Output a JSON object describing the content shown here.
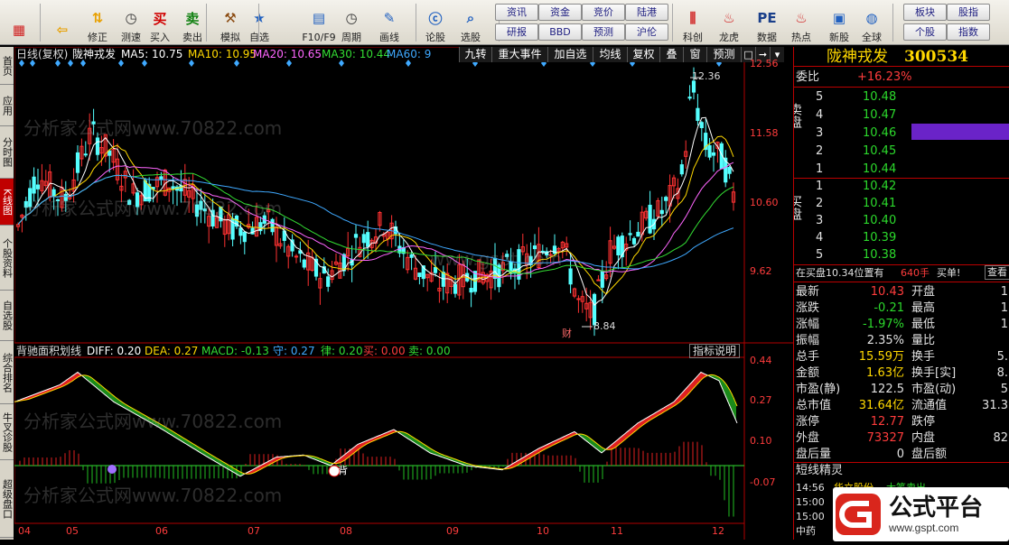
{
  "toolbar": {
    "left": [
      {
        "name": "grid-view",
        "label": "",
        "icon": "grid-icon"
      },
      {
        "name": "back",
        "label": "",
        "icon": "back-arrow-icon"
      },
      {
        "name": "correct",
        "label": "修正",
        "icon": "up-down-icon"
      },
      {
        "name": "test",
        "label": "测速",
        "icon": "clock-icon"
      },
      {
        "name": "buy",
        "label": "买入",
        "icon": "buy-icon",
        "glyph": "买"
      },
      {
        "name": "sell",
        "label": "卖出",
        "icon": "sell-icon",
        "glyph": "卖"
      },
      {
        "name": "simulate",
        "label": "模拟",
        "icon": "hammer-icon"
      },
      {
        "name": "self-select",
        "label": "自选",
        "icon": "star-icon"
      },
      {
        "name": "f10",
        "label": "F10/F9",
        "icon": "doc-icon"
      },
      {
        "name": "period",
        "label": "周期",
        "icon": "clock-icon"
      },
      {
        "name": "draw",
        "label": "画线",
        "icon": "pencil-icon"
      },
      {
        "name": "comment",
        "label": "论股",
        "icon": "forum-icon"
      },
      {
        "name": "select",
        "label": "选股",
        "icon": "magnifier-icon"
      },
      {
        "name": "chart",
        "label": "",
        "icon": "chart-icon"
      },
      {
        "name": "kbox",
        "label": "科创",
        "icon": "kchart-icon"
      },
      {
        "name": "dragon",
        "label": "龙虎",
        "icon": "dragon-icon"
      },
      {
        "name": "data",
        "label": "数据",
        "icon": "pe-icon",
        "glyph": "PE"
      },
      {
        "name": "hot",
        "label": "热点",
        "icon": "fire-icon"
      },
      {
        "name": "newstock",
        "label": "新股",
        "icon": "newstock-icon"
      },
      {
        "name": "global",
        "label": "全球",
        "icon": "globe-icon"
      }
    ],
    "small_buttons": [
      "资讯",
      "资金",
      "竞价",
      "陆港",
      "研报",
      "BBD",
      "预测",
      "沪伦",
      "板块",
      "股指",
      "个股",
      "指数"
    ]
  },
  "left_tabs": [
    "首页",
    "应用",
    "分时图",
    "K线图",
    "个股资料",
    "自选股",
    "综合排名",
    "牛叉诊股",
    "超级盘口"
  ],
  "chart_header": {
    "period": "日线(复权)",
    "name": "陇神戎发",
    "ma5_label": "MA5: 10.75",
    "ma10_label": "MA10: 10.95",
    "ma20_label": "MA20: 10.65",
    "ma30_label": "MA30: 10.44",
    "ma60_label": "MA60: 9",
    "tabs": [
      "九转",
      "重大事件",
      "加自选",
      "均线",
      "复权",
      "叠",
      "窗",
      "预测"
    ]
  },
  "price_axis": [
    "12.56",
    "11.58",
    "10.60",
    "9.62"
  ],
  "price_annotations": {
    "high": "12.36",
    "low": "8.84",
    "cai": "财"
  },
  "indicator_header": {
    "name": "背驰面积划线",
    "diff": "DIFF: 0.20",
    "dea": "DEA: 0.27",
    "macd": "MACD: -0.13",
    "shou": "守: 0.27",
    "lv": "律: 0.20",
    "buy": "买: 0.00",
    "sell": "卖: 0.00",
    "help": "指标说明"
  },
  "indicator_axis": [
    "0.44",
    "0.27",
    "0.10",
    "-0.07"
  ],
  "indicator_marks": {
    "bei": "背"
  },
  "x_axis": [
    "04",
    "05",
    "06",
    "07",
    "08",
    "09",
    "10",
    "11",
    "12"
  ],
  "watermark": [
    "分析家公式网www.70822.com",
    "www.gspt.com"
  ],
  "quote": {
    "name": "陇神戎发",
    "code": "300534",
    "weibi_label": "委比",
    "weibi": "+16.23%",
    "sell_side_label": "卖盘",
    "buy_side_label": "买盘",
    "asks": [
      {
        "lv": "5",
        "price": "10.48",
        "vol": ""
      },
      {
        "lv": "4",
        "price": "10.47",
        "vol": ""
      },
      {
        "lv": "3",
        "price": "10.46",
        "vol": ""
      },
      {
        "lv": "2",
        "price": "10.45",
        "vol": ""
      },
      {
        "lv": "1",
        "price": "10.44",
        "vol": ""
      }
    ],
    "bids": [
      {
        "lv": "1",
        "price": "10.42",
        "vol": ""
      },
      {
        "lv": "2",
        "price": "10.41",
        "vol": ""
      },
      {
        "lv": "3",
        "price": "10.40",
        "vol": ""
      },
      {
        "lv": "4",
        "price": "10.39",
        "vol": ""
      },
      {
        "lv": "5",
        "price": "10.38",
        "vol": ""
      }
    ],
    "pos_label": "在买盘10.34位置有",
    "pos_vol": "640手",
    "pos_action": "买单!",
    "pos_view": "查看",
    "stats": [
      {
        "l": "最新",
        "v": "10.43",
        "c": "red",
        "l2": "开盘",
        "v2": "1"
      },
      {
        "l": "涨跌",
        "v": "-0.21",
        "c": "grn",
        "l2": "最高",
        "v2": "1"
      },
      {
        "l": "涨幅",
        "v": "-1.97%",
        "c": "grn",
        "l2": "最低",
        "v2": "1"
      },
      {
        "l": "振幅",
        "v": "2.35%",
        "c": "wht",
        "l2": "量比",
        "v2": ""
      },
      {
        "l": "总手",
        "v": "15.59万",
        "c": "yel",
        "l2": "换手",
        "v2": "5."
      },
      {
        "l": "金额",
        "v": "1.63亿",
        "c": "yel",
        "l2": "换手[实]",
        "v2": "8."
      },
      {
        "l": "市盈(静)",
        "v": "122.5",
        "c": "wht",
        "l2": "市盈(动)",
        "v2": "5"
      },
      {
        "l": "总市值",
        "v": "31.64亿",
        "c": "yel",
        "l2": "流通值",
        "v2": "31.3"
      },
      {
        "l": "涨停",
        "v": "12.77",
        "c": "red",
        "l2": "跌停",
        "v2": ""
      },
      {
        "l": "外盘",
        "v": "73327",
        "c": "red",
        "l2": "内盘",
        "v2": "82"
      },
      {
        "l": "盘后量",
        "v": "0",
        "c": "wht",
        "l2": "盘后额",
        "v2": ""
      }
    ],
    "short_title": "短线精灵",
    "short_rows": [
      {
        "t": "14:56",
        "n": "华立股份",
        "e": "大笔卖出"
      },
      {
        "t": "15:00",
        "n": "",
        "e": ""
      },
      {
        "t": "15:00",
        "n": "",
        "e": ""
      },
      {
        "t": "中药",
        "n": "",
        "e": ""
      }
    ]
  },
  "brand": {
    "text": "公式平台",
    "url": "www.gspt.com"
  },
  "chart_data": {
    "type": "candlestick",
    "price_range": [
      8.84,
      12.56
    ],
    "ma5": 10.75,
    "ma10": 10.95,
    "ma20": 10.65,
    "ma30": 10.44,
    "ma60": 9,
    "high": 12.36,
    "low": 8.84,
    "indicator_range": [
      -0.07,
      0.44
    ],
    "diff": 0.2,
    "dea": 0.27,
    "macd": -0.13
  }
}
